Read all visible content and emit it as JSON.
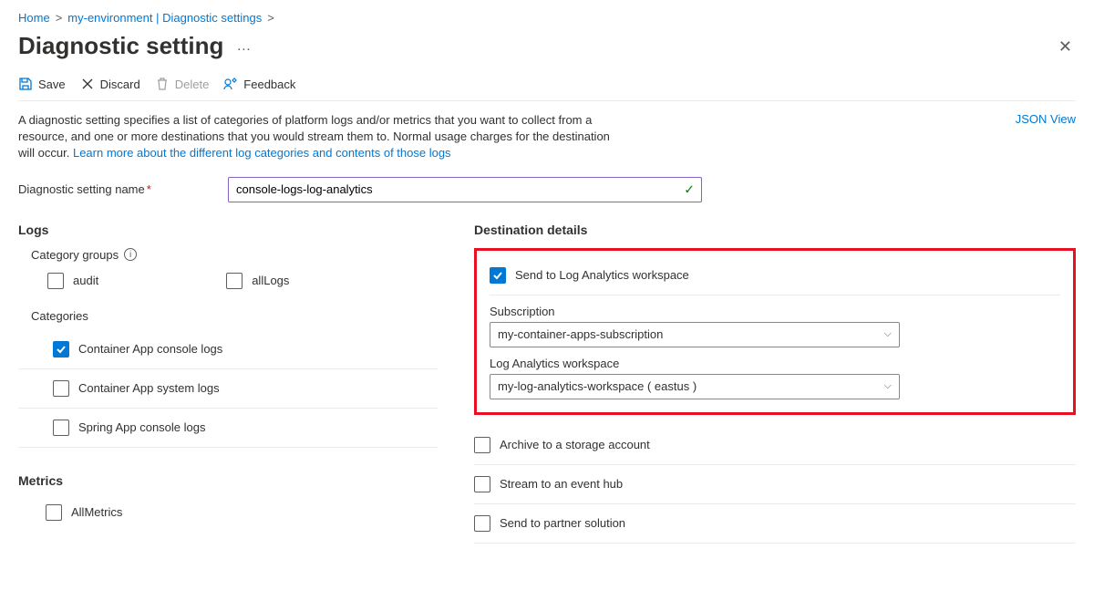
{
  "breadcrumb": {
    "home": "Home",
    "env": "my-environment | Diagnostic settings"
  },
  "page": {
    "title": "Diagnostic setting"
  },
  "toolbar": {
    "save": "Save",
    "discard": "Discard",
    "delete": "Delete",
    "feedback": "Feedback"
  },
  "intro": {
    "text1": "A diagnostic setting specifies a list of categories of platform logs and/or metrics that you want to collect from a resource, and one or more destinations that you would stream them to. Normal usage charges for the destination will occur. ",
    "link": "Learn more about the different log categories and contents of those logs",
    "json_view": "JSON View"
  },
  "name_field": {
    "label": "Diagnostic setting name",
    "value": "console-logs-log-analytics"
  },
  "logs": {
    "heading": "Logs",
    "category_groups_label": "Category groups",
    "groups": [
      {
        "label": "audit",
        "checked": false
      },
      {
        "label": "allLogs",
        "checked": false
      }
    ],
    "categories_label": "Categories",
    "categories": [
      {
        "label": "Container App console logs",
        "checked": true
      },
      {
        "label": "Container App system logs",
        "checked": false
      },
      {
        "label": "Spring App console logs",
        "checked": false
      }
    ]
  },
  "metrics": {
    "heading": "Metrics",
    "items": [
      {
        "label": "AllMetrics",
        "checked": false
      }
    ]
  },
  "dest": {
    "heading": "Destination details",
    "log_analytics": {
      "label": "Send to Log Analytics workspace",
      "checked": true
    },
    "subscription": {
      "label": "Subscription",
      "value": "my-container-apps-subscription"
    },
    "workspace": {
      "label": "Log Analytics workspace",
      "value": "my-log-analytics-workspace ( eastus )"
    },
    "storage": {
      "label": "Archive to a storage account",
      "checked": false
    },
    "eventhub": {
      "label": "Stream to an event hub",
      "checked": false
    },
    "partner": {
      "label": "Send to partner solution",
      "checked": false
    }
  }
}
